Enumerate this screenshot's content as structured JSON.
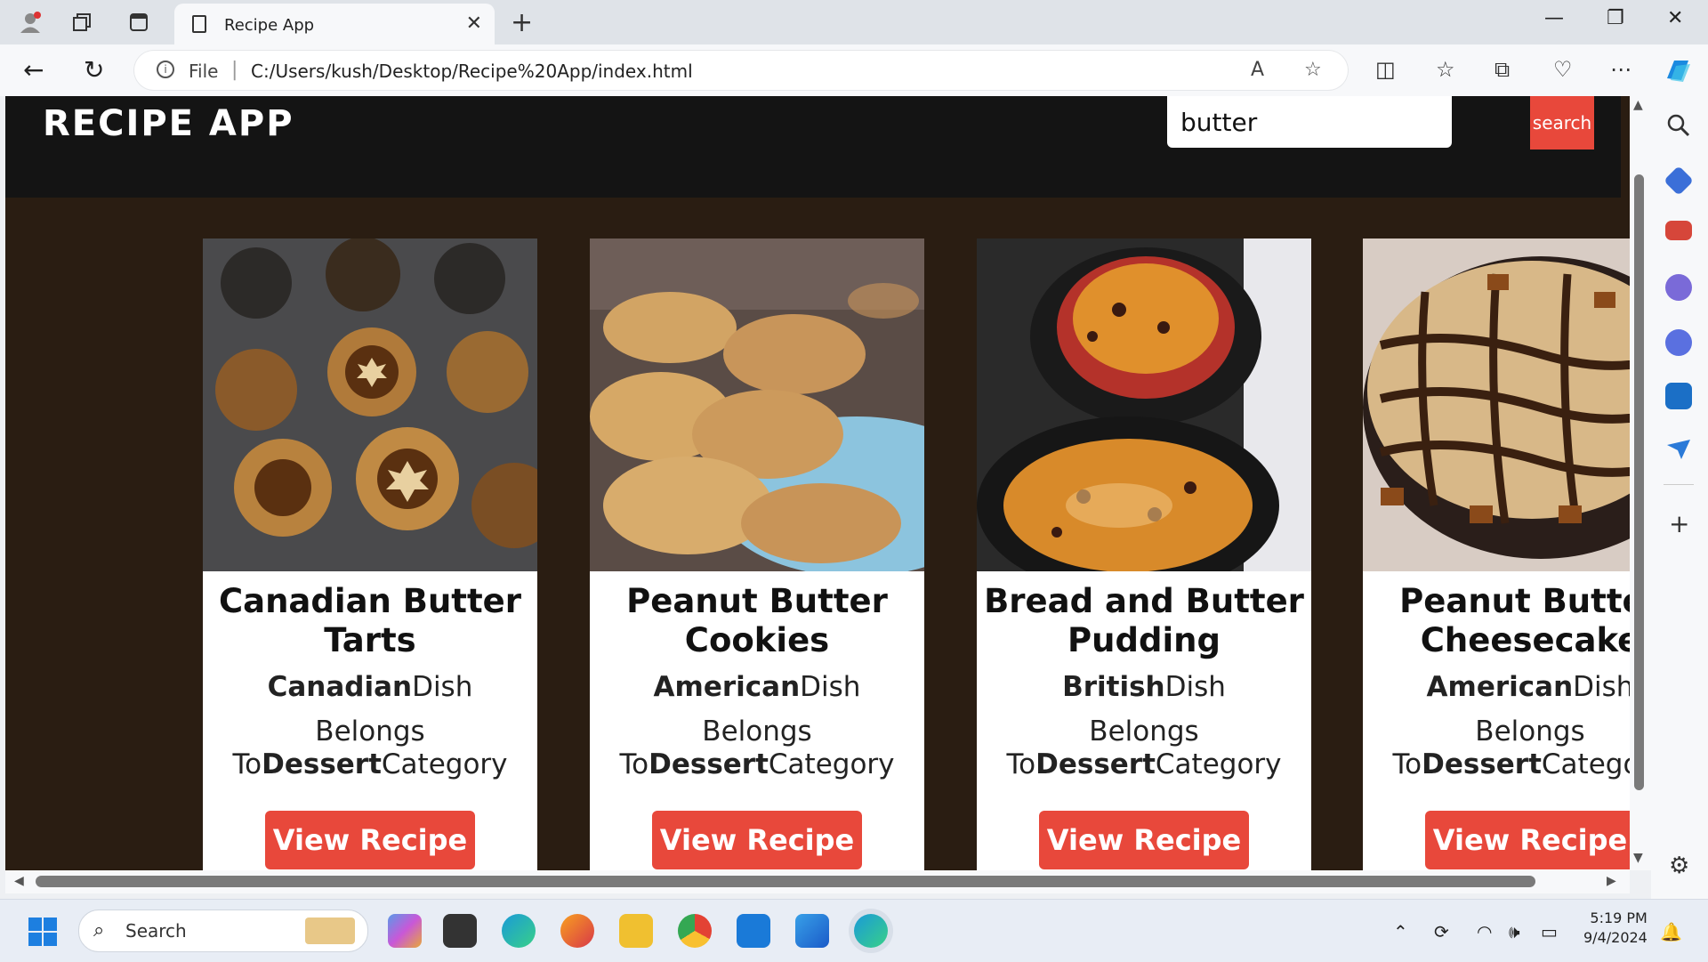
{
  "browser": {
    "tab_title": "Recipe App",
    "address_prefix": "File",
    "url": "C:/Users/kush/Desktop/Recipe%20App/index.html"
  },
  "page": {
    "app_title": "RECIPE APP",
    "search": {
      "value": "butter",
      "button_label": "search"
    },
    "cards": [
      {
        "name": "Canadian Butter Tarts",
        "area": "Canadian",
        "area_suffix": "Dish",
        "cat_prefix": "Belongs",
        "cat_to": "To",
        "category": "Dessert",
        "cat_suffix": "Category",
        "button": "View Recipe"
      },
      {
        "name": "Peanut Butter Cookies",
        "area": "American",
        "area_suffix": "Dish",
        "cat_prefix": "Belongs",
        "cat_to": "To",
        "category": "Dessert",
        "cat_suffix": "Category",
        "button": "View Recipe"
      },
      {
        "name": "Bread and Butter Pudding",
        "area": "British",
        "area_suffix": "Dish",
        "cat_prefix": "Belongs",
        "cat_to": "To",
        "category": "Dessert",
        "cat_suffix": "Category",
        "button": "View Recipe"
      },
      {
        "name": "Peanut Butter Cheesecake",
        "area": "American",
        "area_suffix": "Dish",
        "cat_prefix": "Belongs",
        "cat_to": "To",
        "category": "Dessert",
        "cat_suffix": "Category",
        "button": "View Recipe"
      }
    ]
  },
  "taskbar": {
    "search_label": "Search",
    "time": "5:19 PM",
    "date": "9/4/2024"
  },
  "colors": {
    "accent": "#e8483b",
    "page_bg": "#2a1d12",
    "header_bg": "#141414"
  }
}
